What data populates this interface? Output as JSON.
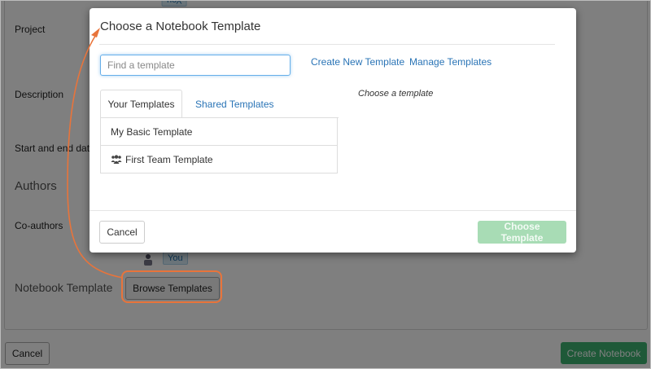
{
  "background": {
    "badge_top": "You",
    "labels": {
      "project": "Project",
      "description": "Description",
      "dates": "Start and end date",
      "co_authors": "Co-authors"
    },
    "sections": {
      "authors": "Authors",
      "notebook_template": "Notebook Template"
    },
    "badge_you": "You",
    "browse_label": "Browse Templates",
    "cancel_label": "Cancel",
    "create_label": "Create Notebook"
  },
  "modal": {
    "title": "Choose a Notebook Template",
    "search": {
      "placeholder": "Find a template",
      "value": ""
    },
    "links": {
      "create_new": "Create New Template",
      "manage": "Manage Templates"
    },
    "tabs": [
      {
        "label": "Your Templates",
        "active": true
      },
      {
        "label": "Shared Templates",
        "active": false
      }
    ],
    "templates": [
      {
        "label": "My Basic Template",
        "icon": ""
      },
      {
        "label": "First Team Template",
        "icon": "team-icon"
      }
    ],
    "preview_text": "Choose a template",
    "cancel_label": "Cancel",
    "choose_label": "Choose Template"
  },
  "colors": {
    "accent_link": "#2a74b6",
    "primary_green": "#3cb371",
    "disabled_green": "#a8dcb5",
    "callout_orange": "#e8743b"
  }
}
